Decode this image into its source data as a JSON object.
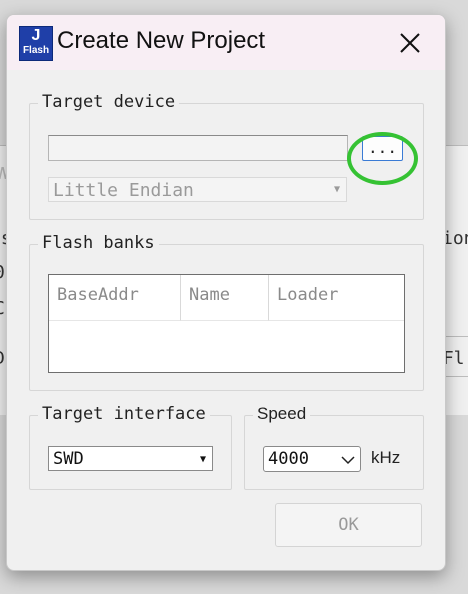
{
  "background": {
    "fragments": [
      "W",
      "es",
      "ion",
      "0",
      "C",
      "D",
      "-Fl"
    ]
  },
  "dialog": {
    "icon": {
      "top": "J",
      "bottom": "Flash"
    },
    "title": "Create New Project",
    "close_icon": "close-icon",
    "target_device": {
      "legend": "Target device",
      "device_value": "",
      "browse_label": "...",
      "endian_value": "Little Endian",
      "highlight_color": "#35c233"
    },
    "flash_banks": {
      "legend": "Flash banks",
      "columns": [
        "BaseAddr",
        "Name",
        "Loader"
      ],
      "rows": []
    },
    "target_interface": {
      "legend": "Target interface",
      "value": "SWD"
    },
    "speed": {
      "legend": "Speed",
      "value": "4000",
      "unit": "kHz"
    },
    "ok_label": "OK"
  }
}
